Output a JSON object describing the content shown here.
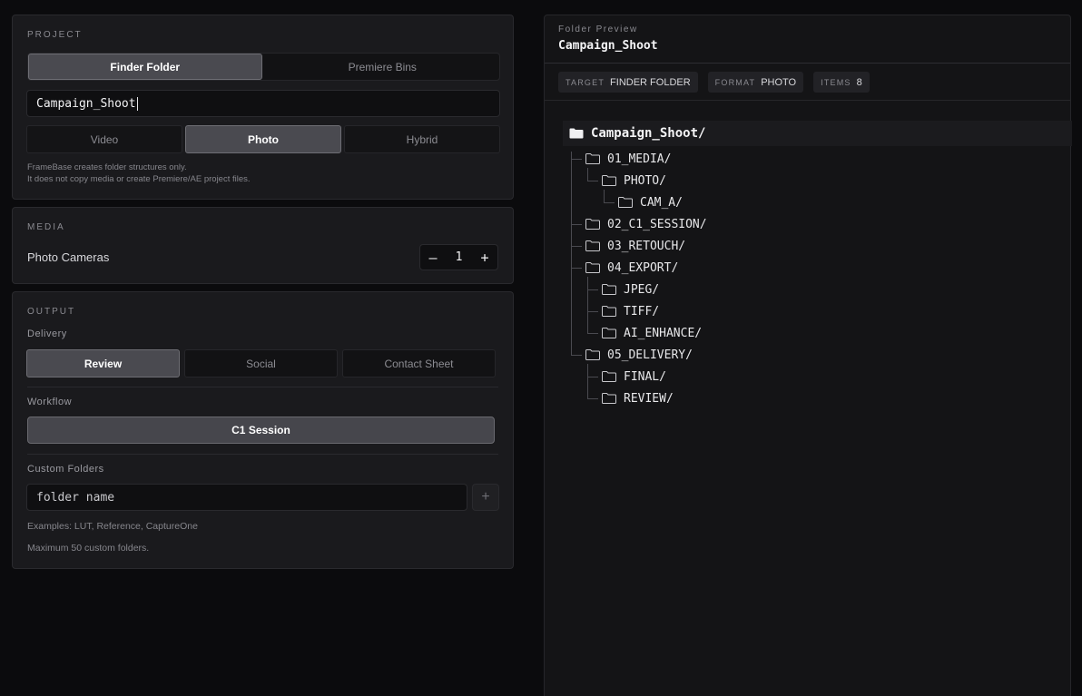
{
  "project": {
    "section_title": "PROJECT",
    "target_options": [
      "Finder Folder",
      "Premiere Bins"
    ],
    "target_selected": "Finder Folder",
    "name_value": "Campaign_Shoot",
    "format_options": [
      "Video",
      "Photo",
      "Hybrid"
    ],
    "format_selected": "Photo",
    "note_line1": "FrameBase creates folder structures only.",
    "note_line2": "It does not copy media or create Premiere/AE project files."
  },
  "media": {
    "section_title": "MEDIA",
    "photo_cameras_label": "Photo Cameras",
    "photo_cameras_value": "1",
    "decrement_symbol": "–",
    "increment_symbol": "+"
  },
  "output": {
    "section_title": "OUTPUT",
    "delivery_label": "Delivery",
    "delivery_options": [
      "Review",
      "Social",
      "Contact Sheet"
    ],
    "delivery_selected": "Review",
    "workflow_label": "Workflow",
    "workflow_value": "C1 Session",
    "custom_folders_label": "Custom Folders",
    "custom_folder_placeholder": "folder name",
    "add_symbol": "+",
    "examples_text": "Examples: LUT, Reference, CaptureOne",
    "max_text": "Maximum 50 custom folders."
  },
  "preview": {
    "label": "Folder Preview",
    "title": "Campaign_Shoot",
    "chips": [
      {
        "key": "TARGET",
        "value": "FINDER FOLDER"
      },
      {
        "key": "FORMAT",
        "value": "PHOTO"
      },
      {
        "key": "ITEMS",
        "value": "8"
      }
    ],
    "root": "Campaign_Shoot/",
    "tree": [
      {
        "label": "01_MEDIA/",
        "depth": 1
      },
      {
        "label": "PHOTO/",
        "depth": 2
      },
      {
        "label": "CAM_A/",
        "depth": 3
      },
      {
        "label": "02_C1_SESSION/",
        "depth": 1
      },
      {
        "label": "03_RETOUCH/",
        "depth": 1
      },
      {
        "label": "04_EXPORT/",
        "depth": 1
      },
      {
        "label": "JPEG/",
        "depth": 2
      },
      {
        "label": "TIFF/",
        "depth": 2
      },
      {
        "label": "AI_ENHANCE/",
        "depth": 2
      },
      {
        "label": "05_DELIVERY/",
        "depth": 1
      },
      {
        "label": "FINAL/",
        "depth": 2
      },
      {
        "label": "REVIEW/",
        "depth": 2
      }
    ]
  },
  "colors": {
    "background": "#0b0b0d",
    "panel": "#1a1a1d",
    "active_button": "#4a4a50"
  }
}
